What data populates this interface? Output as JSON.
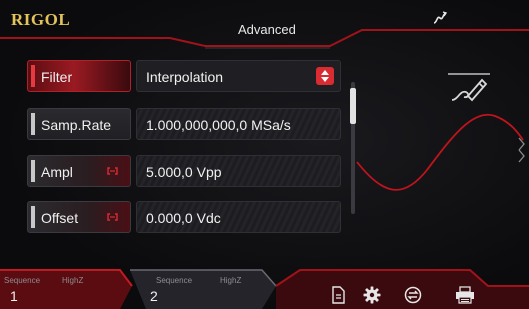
{
  "header": {
    "brand": "RIGOL",
    "title": "Advanced"
  },
  "params": [
    {
      "label": "Filter",
      "value": "Interpolation",
      "linked": false
    },
    {
      "label": "Samp.Rate",
      "value": "1.000,000,000,0 MSa/s",
      "linked": false
    },
    {
      "label": "Ampl",
      "value": "5.000,0 Vpp",
      "linked": true
    },
    {
      "label": "Offset",
      "value": "0.000,0 Vdc",
      "linked": true
    }
  ],
  "channels": [
    {
      "number": "1",
      "mode": "Sequence",
      "impedance": "HighZ"
    },
    {
      "number": "2",
      "mode": "Sequence",
      "impedance": "HighZ"
    }
  ],
  "icons": {
    "sweep": "sweep-icon",
    "edit": "pen-edit-icon",
    "file": "file-icon",
    "settings": "gear-icon",
    "sync": "sync-icon",
    "print": "printer-icon"
  },
  "colors": {
    "accent": "#d92c32",
    "brand": "#e3c35a"
  }
}
